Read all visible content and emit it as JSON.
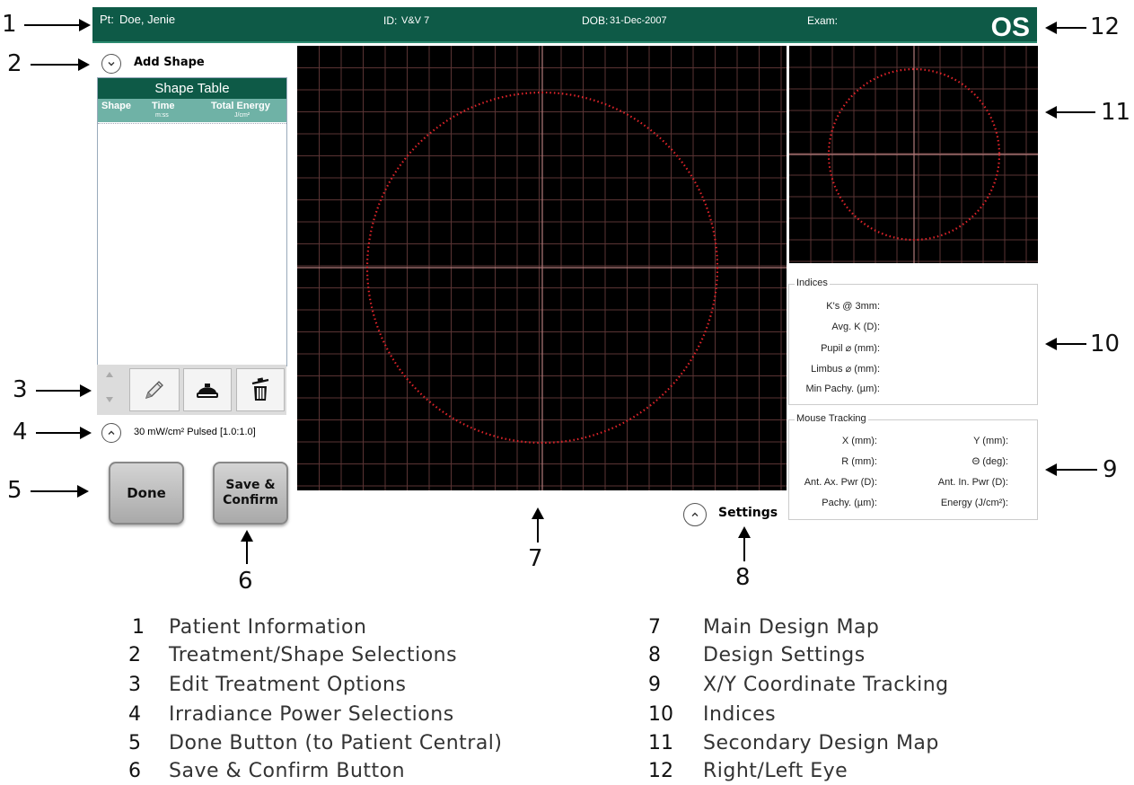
{
  "header": {
    "patient_label": "Pt:",
    "patient_name": "Doe, Jenie",
    "id_label": "ID:",
    "id_value": "V&V 7",
    "dob_label": "DOB:",
    "dob_value": "31-Dec-2007",
    "exam_label": "Exam:",
    "exam_value": "",
    "eye": "OS"
  },
  "add_shape": {
    "label": "Add Shape",
    "icon": "chevron-down-icon"
  },
  "shape_table": {
    "title": "Shape Table",
    "columns": [
      {
        "label": "Shape",
        "unit": ""
      },
      {
        "label": "Time",
        "unit": "m:ss"
      },
      {
        "label": "Total Energy",
        "unit": "J/cm²"
      }
    ],
    "rows": []
  },
  "edit_options": {
    "up_icon": "triangle-up-icon",
    "down_icon": "triangle-down-icon",
    "edit_icon": "pencil-icon",
    "lamp_icon": "lamp-icon",
    "delete_icon": "trash-icon"
  },
  "irradiance": {
    "label": "30 mW/cm² Pulsed [1.0:1.0]",
    "icon": "chevron-up-icon"
  },
  "buttons": {
    "done": "Done",
    "save_line1": "Save &",
    "save_line2": "Confirm"
  },
  "settings": {
    "label": "Settings",
    "icon": "chevron-up-icon"
  },
  "indices": {
    "title": "Indices",
    "items": [
      {
        "label": "K's @ 3mm:",
        "value": ""
      },
      {
        "label": "Avg. K (D):",
        "value": ""
      },
      {
        "label": "Pupil ⌀ (mm):",
        "value": ""
      },
      {
        "label": "Limbus ⌀ (mm):",
        "value": ""
      },
      {
        "label": "Min Pachy. (µm):",
        "value": ""
      }
    ]
  },
  "mouse_tracking": {
    "title": "Mouse Tracking",
    "left": [
      "X (mm):",
      "R (mm):",
      "Ant. Ax. Pwr (D):",
      "Pachy. (µm):"
    ],
    "right": [
      "Y (mm):",
      "Θ (deg):",
      "Ant. In. Pwr (D):",
      "Energy (J/cm²):"
    ]
  },
  "callouts": [
    "1",
    "2",
    "3",
    "4",
    "5",
    "6",
    "7",
    "8",
    "9",
    "10",
    "11",
    "12"
  ],
  "legend": [
    {
      "num": "1",
      "text": "Patient Information"
    },
    {
      "num": "2",
      "text": "Treatment/Shape Selections"
    },
    {
      "num": "3",
      "text": "Edit Treatment Options"
    },
    {
      "num": "4",
      "text": "Irradiance Power Selections"
    },
    {
      "num": "5",
      "text": "Done Button (to Patient Central)"
    },
    {
      "num": "6",
      "text": "Save & Confirm Button"
    },
    {
      "num": "7",
      "text": "Main Design Map"
    },
    {
      "num": "8",
      "text": "Design Settings"
    },
    {
      "num": "9",
      "text": "X/Y Coordinate Tracking"
    },
    {
      "num": "10",
      "text": "Indices"
    },
    {
      "num": "11",
      "text": "Secondary Design Map"
    },
    {
      "num": "12",
      "text": "Right/Left Eye"
    }
  ],
  "colors": {
    "header_bg": "#0e5a47",
    "table_header_bg": "#6fb2a6",
    "map_bg": "#000000",
    "grid": "#5a3434",
    "circle": "#e0242a"
  }
}
